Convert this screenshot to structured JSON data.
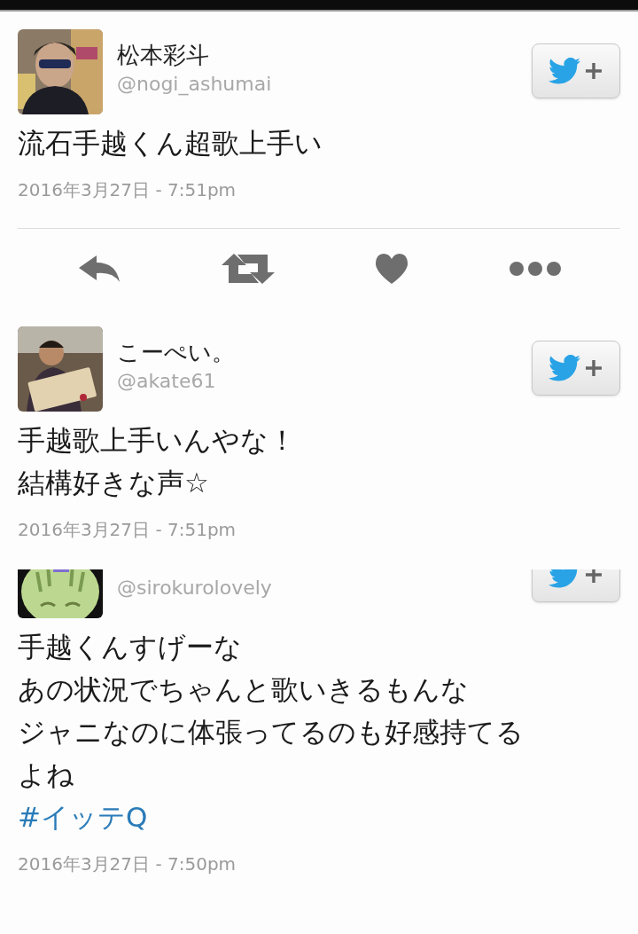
{
  "tweets": [
    {
      "name": "松本彩斗",
      "handle": "@nogi_ashumai",
      "lines": [
        "流石手越くん超歌上手い"
      ],
      "date": "2016年3月27日 - 7:51pm",
      "expanded": true,
      "clipped": false
    },
    {
      "name": "こーぺい。",
      "handle": "@akate61",
      "lines": [
        "手越歌上手いんやな！",
        "結構好きな声☆"
      ],
      "date": "2016年3月27日 - 7:51pm",
      "expanded": false,
      "clipped": false
    },
    {
      "handle": "@sirokurolovely",
      "lines": [
        "手越くんすげーな",
        "あの状況でちゃんと歌いきるもんな",
        "ジャニなのに体張ってるのも好感持てる",
        "よね"
      ],
      "hashtag": "#イッテQ",
      "date": "2016年3月27日 - 7:50pm",
      "expanded": false,
      "clipped": true
    }
  ]
}
